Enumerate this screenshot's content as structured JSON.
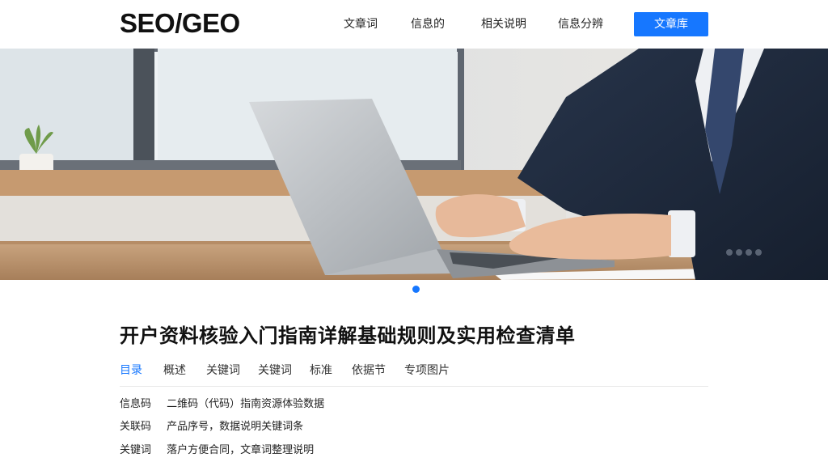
{
  "header": {
    "logo": "SEO/GEO",
    "nav": [
      "文章词",
      "信息的",
      "相关说明",
      "信息分辨"
    ],
    "button": "文章库"
  },
  "hero": {
    "image": "business-person-typing-on-laptop",
    "slide_indicator_color": "#1677ff"
  },
  "article": {
    "title": "开户资料核验入门指南详解基础规则及实用检查清单",
    "tabs": [
      "目录",
      "概述",
      "关键词",
      "关键词",
      "标准",
      "依据节",
      "专项图片"
    ],
    "active_tab": 0,
    "rows": [
      {
        "key": "信息码",
        "value": "二维码（代码）指南资源体验数据"
      },
      {
        "key": "关联码",
        "value": "产品序号，数据说明关键词条"
      },
      {
        "key": "关键词",
        "value": "落户方便合同，文章词整理说明"
      }
    ]
  },
  "colors": {
    "accent": "#1677ff",
    "text": "#111111",
    "divider": "#e8e8e8"
  }
}
